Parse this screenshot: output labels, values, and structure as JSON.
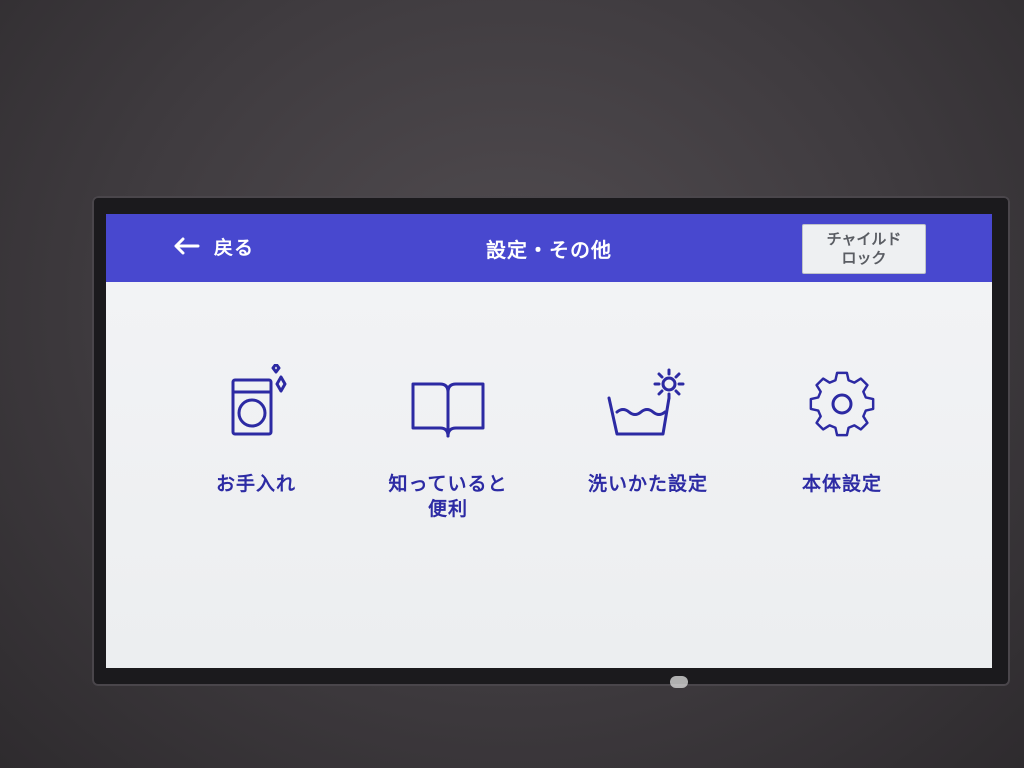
{
  "header": {
    "back_label": "戻る",
    "title": "設定・その他",
    "child_lock_line1": "チャイルド",
    "child_lock_line2": "ロック"
  },
  "menu": {
    "items": [
      {
        "label": "お手入れ",
        "icon": "washer-sparkle-icon"
      },
      {
        "label_line1": "知っていると",
        "label_line2": "便利",
        "icon": "open-book-icon"
      },
      {
        "label": "洗いかた設定",
        "icon": "wash-tub-gear-icon"
      },
      {
        "label": "本体設定",
        "icon": "gear-icon"
      }
    ]
  },
  "colors": {
    "header_bg": "#4848cf",
    "accent": "#2c2aa3",
    "screen_bg": "#f0f1f3"
  }
}
